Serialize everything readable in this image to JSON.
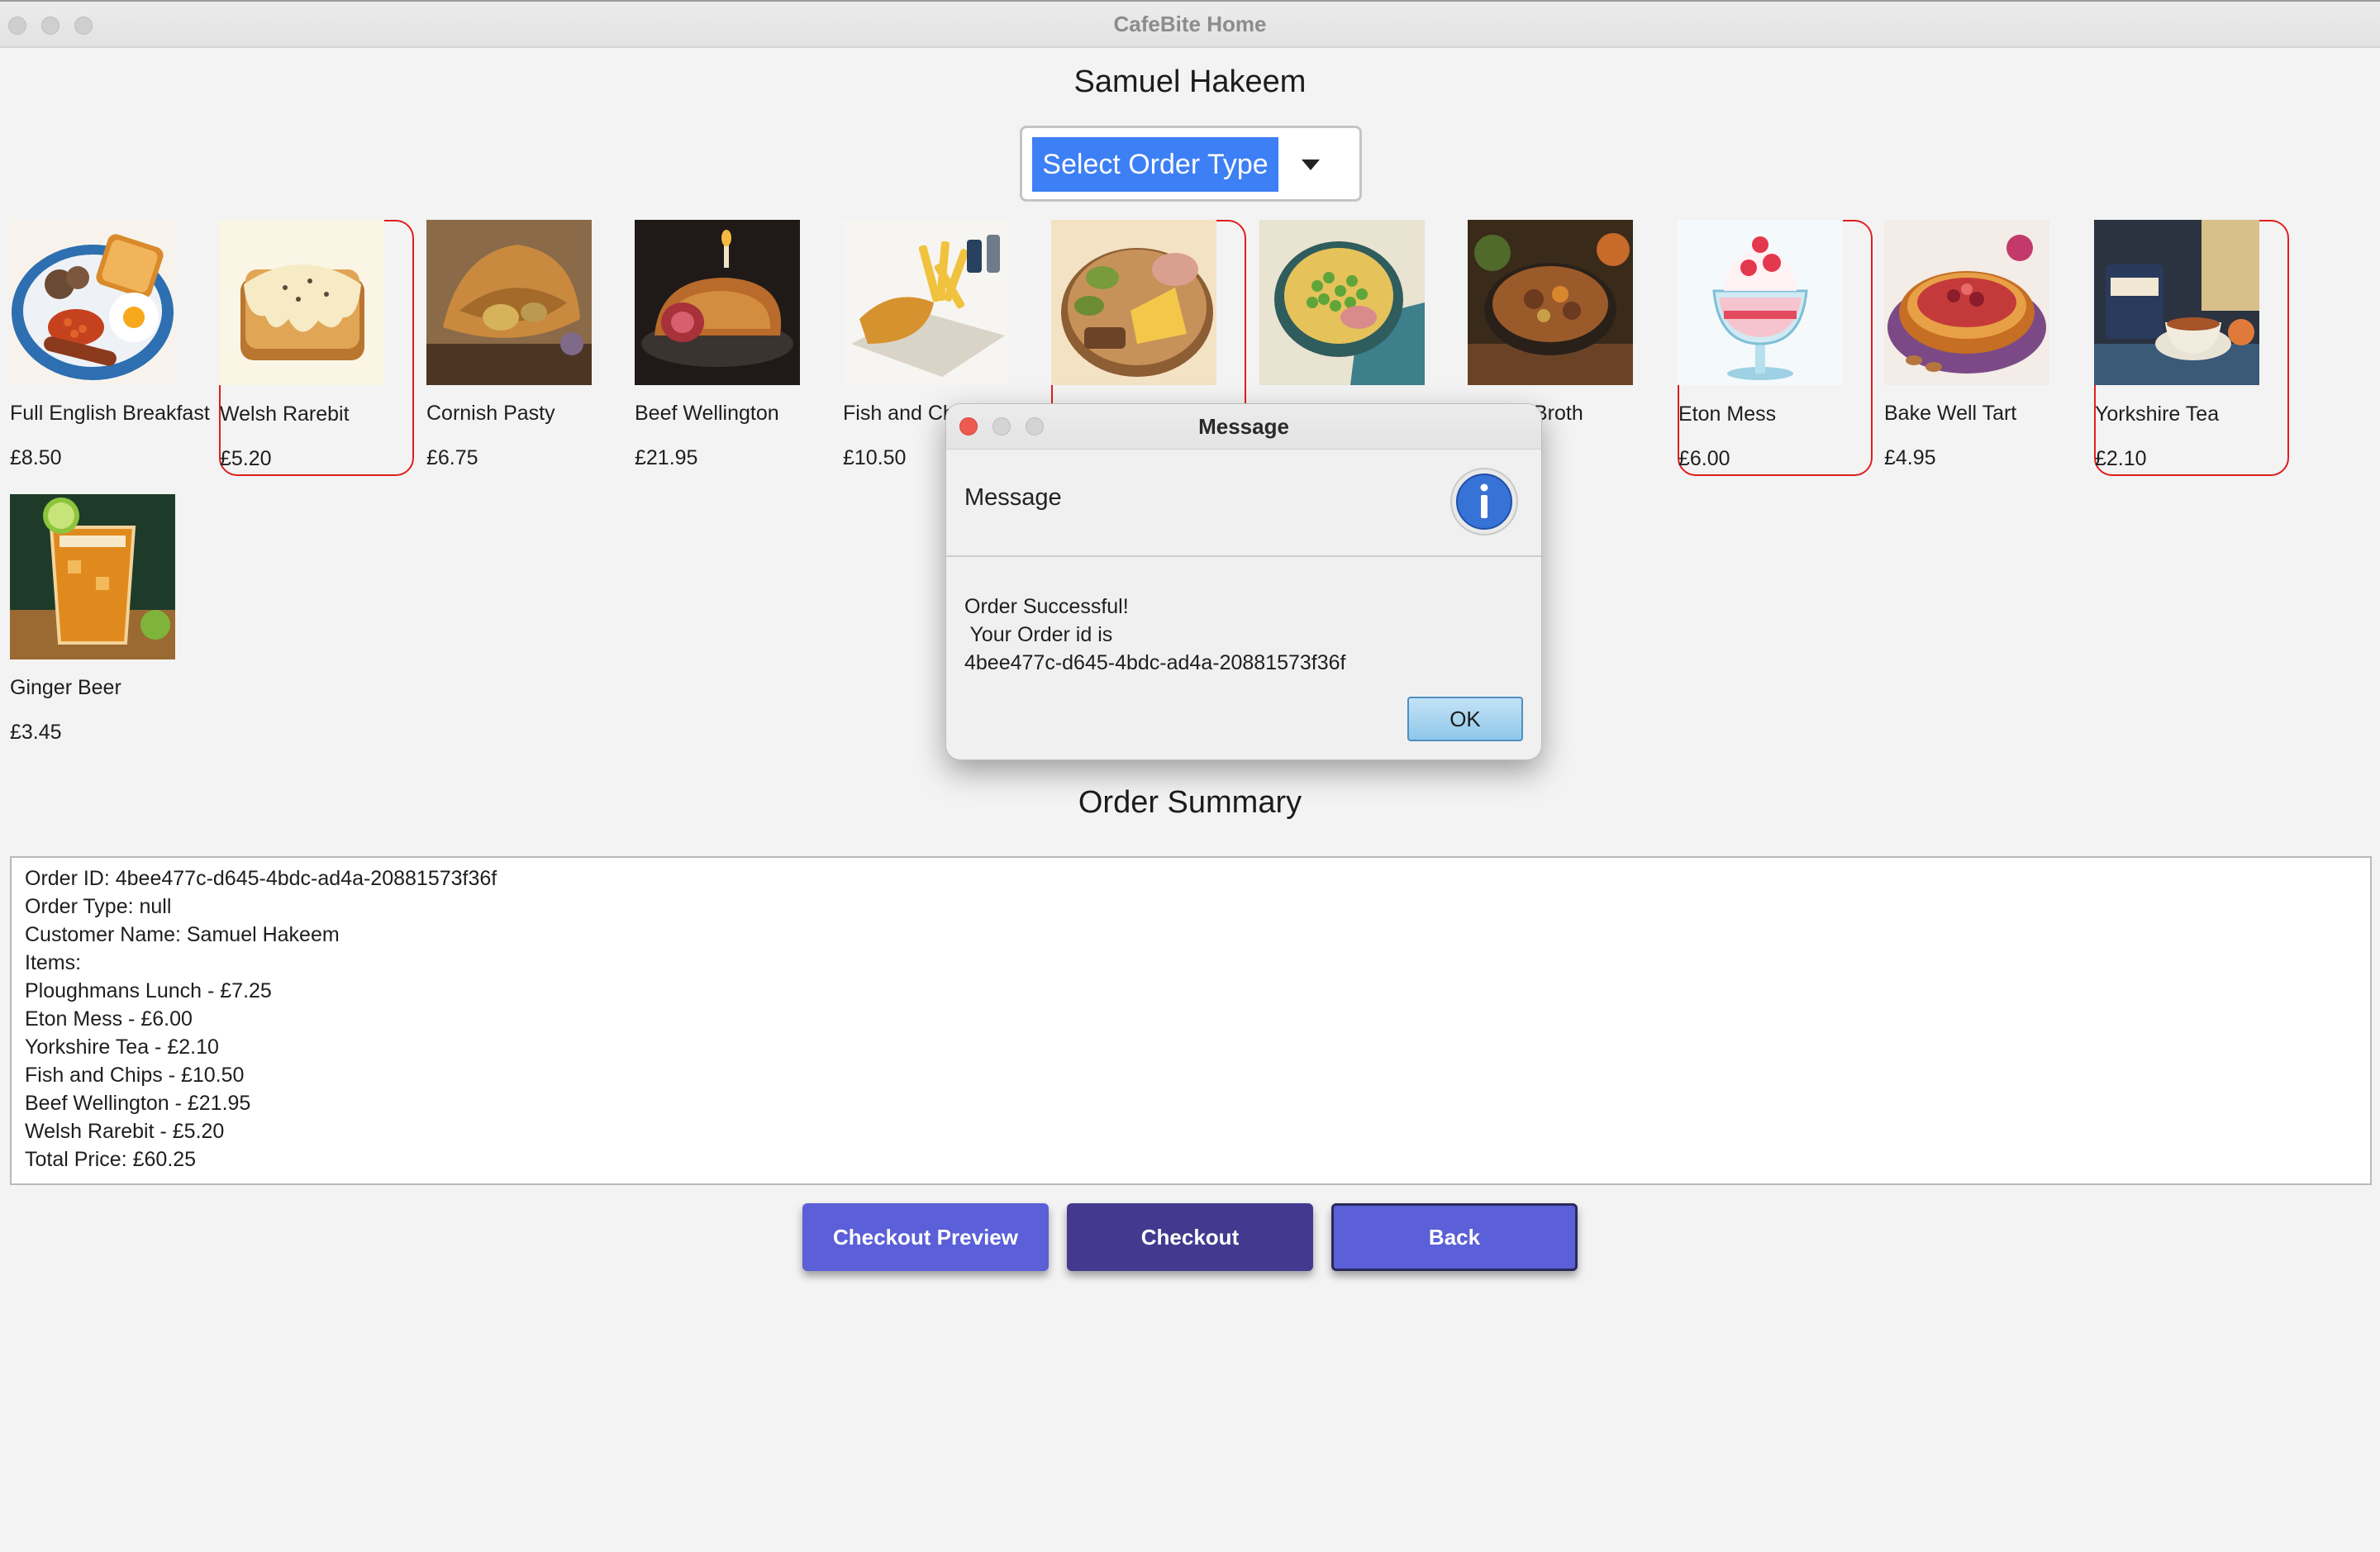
{
  "window": {
    "title": "CafeBite Home"
  },
  "header": {
    "customer_name": "Samuel Hakeem",
    "order_type_label": "Select Order Type"
  },
  "menu_items": [
    {
      "name": "Full English Breakfast",
      "price": "£8.50",
      "selected": false,
      "icon": "full-english-breakfast-image"
    },
    {
      "name": "Welsh Rarebit",
      "price": "£5.20",
      "selected": true,
      "icon": "welsh-rarebit-image"
    },
    {
      "name": "Cornish Pasty",
      "price": "£6.75",
      "selected": false,
      "icon": "cornish-pasty-image"
    },
    {
      "name": "Beef Wellington",
      "price": "£21.95",
      "selected": false,
      "icon": "beef-wellington-image"
    },
    {
      "name": "Fish and Chips",
      "price": "£10.50",
      "selected": false,
      "icon": "fish-and-chips-image"
    },
    {
      "name": "",
      "price": "",
      "selected": true,
      "icon": "ploughmans-lunch-image"
    },
    {
      "name": "",
      "price": "",
      "selected": false,
      "icon": "peas-and-ham-image"
    },
    {
      "name": "Broth",
      "price": "",
      "selected": false,
      "icon": "broth-image"
    },
    {
      "name": "Eton Mess",
      "price": "£6.00",
      "selected": true,
      "icon": "eton-mess-image"
    },
    {
      "name": "Bake Well Tart",
      "price": "£4.95",
      "selected": false,
      "icon": "bakewell-tart-image"
    },
    {
      "name": "Yorkshire Tea",
      "price": "£2.10",
      "selected": true,
      "icon": "yorkshire-tea-image"
    },
    {
      "name": "Ginger Beer",
      "price": "£3.45",
      "selected": false,
      "icon": "ginger-beer-image"
    }
  ],
  "summary": {
    "title": "Order Summary",
    "lines": [
      "Order ID: 4bee477c-d645-4bdc-ad4a-20881573f36f",
      "Order Type: null",
      "Customer Name: Samuel Hakeem",
      "Items:",
      "Ploughmans Lunch - £7.25",
      "Eton Mess - £6.00",
      "Yorkshire Tea - £2.10",
      "Fish and Chips - £10.50",
      "Beef Wellington - £21.95",
      "Welsh Rarebit - £5.20",
      "Total Price: £60.25"
    ]
  },
  "buttons": {
    "checkout_preview": "Checkout Preview",
    "checkout": "Checkout",
    "back": "Back"
  },
  "dialog": {
    "title": "Message",
    "header": "Message",
    "body_line1": "Order Successful!",
    "body_line2": " Your Order id is",
    "body_line3": "4bee477c-d645-4bdc-ad4a-20881573f36f",
    "ok": "OK",
    "icon": "info-icon"
  },
  "colors": {
    "accent": "#3d7ff5",
    "selection_border": "#e01e1e",
    "button_primary": "#5b5fd8",
    "button_dark": "#433a8f"
  }
}
